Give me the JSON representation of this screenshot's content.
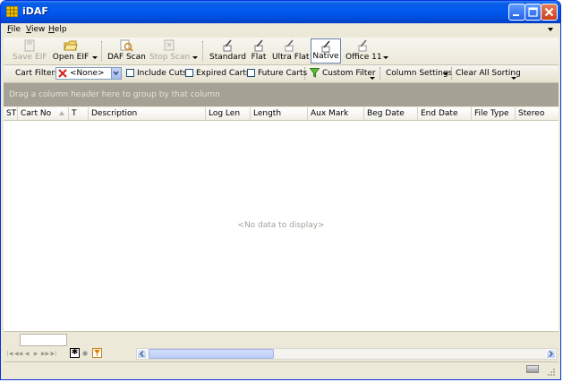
{
  "window": {
    "title": "iDAF",
    "app_icon": "grid-app-icon",
    "controls": [
      "minimize-icon",
      "maximize-icon",
      "close-icon"
    ]
  },
  "menu": {
    "items": [
      {
        "label": "File",
        "accel": "F",
        "rest": "ile"
      },
      {
        "label": "View",
        "accel": "V",
        "rest": "iew"
      },
      {
        "label": "Help",
        "accel": "H",
        "rest": "elp"
      }
    ]
  },
  "toolbar": {
    "save_eif": "Save EIF",
    "open_eif": "Open EIF",
    "daf_scan": "DAF Scan",
    "stop_scan": "Stop Scan",
    "standard": "Standard",
    "flat": "Flat",
    "ultra_flat": "Ultra Flat",
    "native": "Native",
    "office11": "Office 11",
    "active_style": "Native"
  },
  "filters": {
    "cart_filters": "Cart Filters",
    "selected_filter": "<None>",
    "include_cuts": "Include Cuts",
    "expired_carts": "Expired Carts",
    "future_carts": "Future Carts",
    "custom_filter": "Custom Filter",
    "column_settings": "Column Settings",
    "clear_all_sorting": "Clear All Sorting"
  },
  "grid": {
    "group_hint": "Drag a column header here to group by that column",
    "columns": [
      "ST",
      "Cart No",
      "T",
      "Description",
      "Log Len",
      "Length",
      "Aux Mark",
      "Beg Date",
      "End Date",
      "File Type",
      "Stereo"
    ],
    "empty_text": "<No data to display>",
    "rows": []
  },
  "colors": {
    "title_bar": "#0058ee",
    "group_panel": "#a5a295",
    "chrome": "#ece9d8"
  }
}
